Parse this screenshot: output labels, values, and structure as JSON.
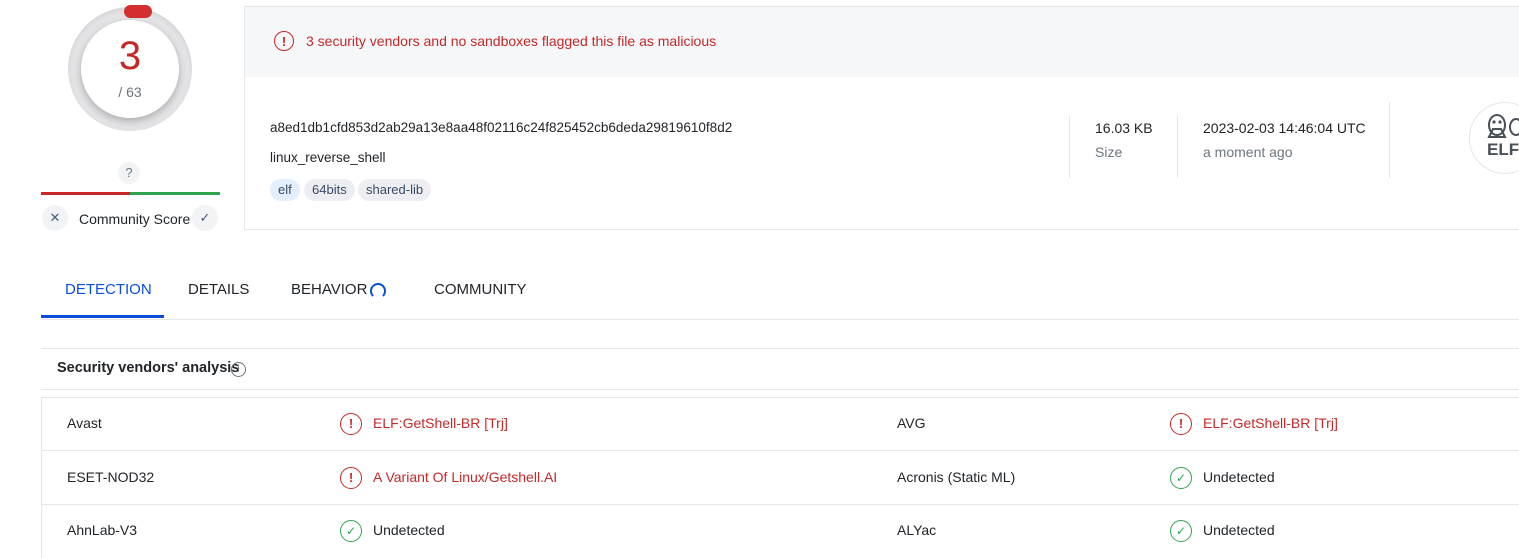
{
  "score": {
    "detections": "3",
    "total": "/ 63",
    "unknown_mark": "?",
    "community_label": "Community Score",
    "dislike_glyph": "✕",
    "like_glyph": "✓"
  },
  "alert": {
    "icon_glyph": "!",
    "text": "3 security vendors and no sandboxes flagged this file as malicious"
  },
  "file": {
    "hash": "a8ed1db1cfd853d2ab29a13e8aa48f02116c24f825452cb6deda29819610f8d2",
    "name": "linux_reverse_shell",
    "tags": [
      "elf",
      "64bits",
      "shared-lib"
    ],
    "size_value": "16.03 KB",
    "size_label": "Size",
    "date_value": "2023-02-03 14:46:04 UTC",
    "date_label": "a moment ago",
    "type_badge": "ELF"
  },
  "tabs": [
    {
      "label": "DETECTION",
      "active": true
    },
    {
      "label": "DETAILS",
      "active": false
    },
    {
      "label": "BEHAVIOR",
      "active": false
    },
    {
      "label": "COMMUNITY",
      "active": false
    }
  ],
  "analysis": {
    "title": "Security vendors' analysis",
    "info_glyph": "i",
    "rows": [
      {
        "left": {
          "vendor": "Avast",
          "result": "ELF:GetShell-BR [Trj]",
          "status": "malicious"
        },
        "right": {
          "vendor": "AVG",
          "result": "ELF:GetShell-BR [Trj]",
          "status": "malicious"
        }
      },
      {
        "left": {
          "vendor": "ESET-NOD32",
          "result": "A Variant Of Linux/Getshell.AI",
          "status": "malicious"
        },
        "right": {
          "vendor": "Acronis (Static ML)",
          "result": "Undetected",
          "status": "undetected"
        }
      },
      {
        "left": {
          "vendor": "AhnLab-V3",
          "result": "Undetected",
          "status": "undetected"
        },
        "right": {
          "vendor": "ALYac",
          "result": "Undetected",
          "status": "undetected"
        }
      }
    ],
    "glyph_malicious": "!",
    "glyph_undetected": "✓"
  },
  "colors": {
    "malicious": "#c62828",
    "undetected": "#2ea44f",
    "accent": "#0b4dda"
  }
}
